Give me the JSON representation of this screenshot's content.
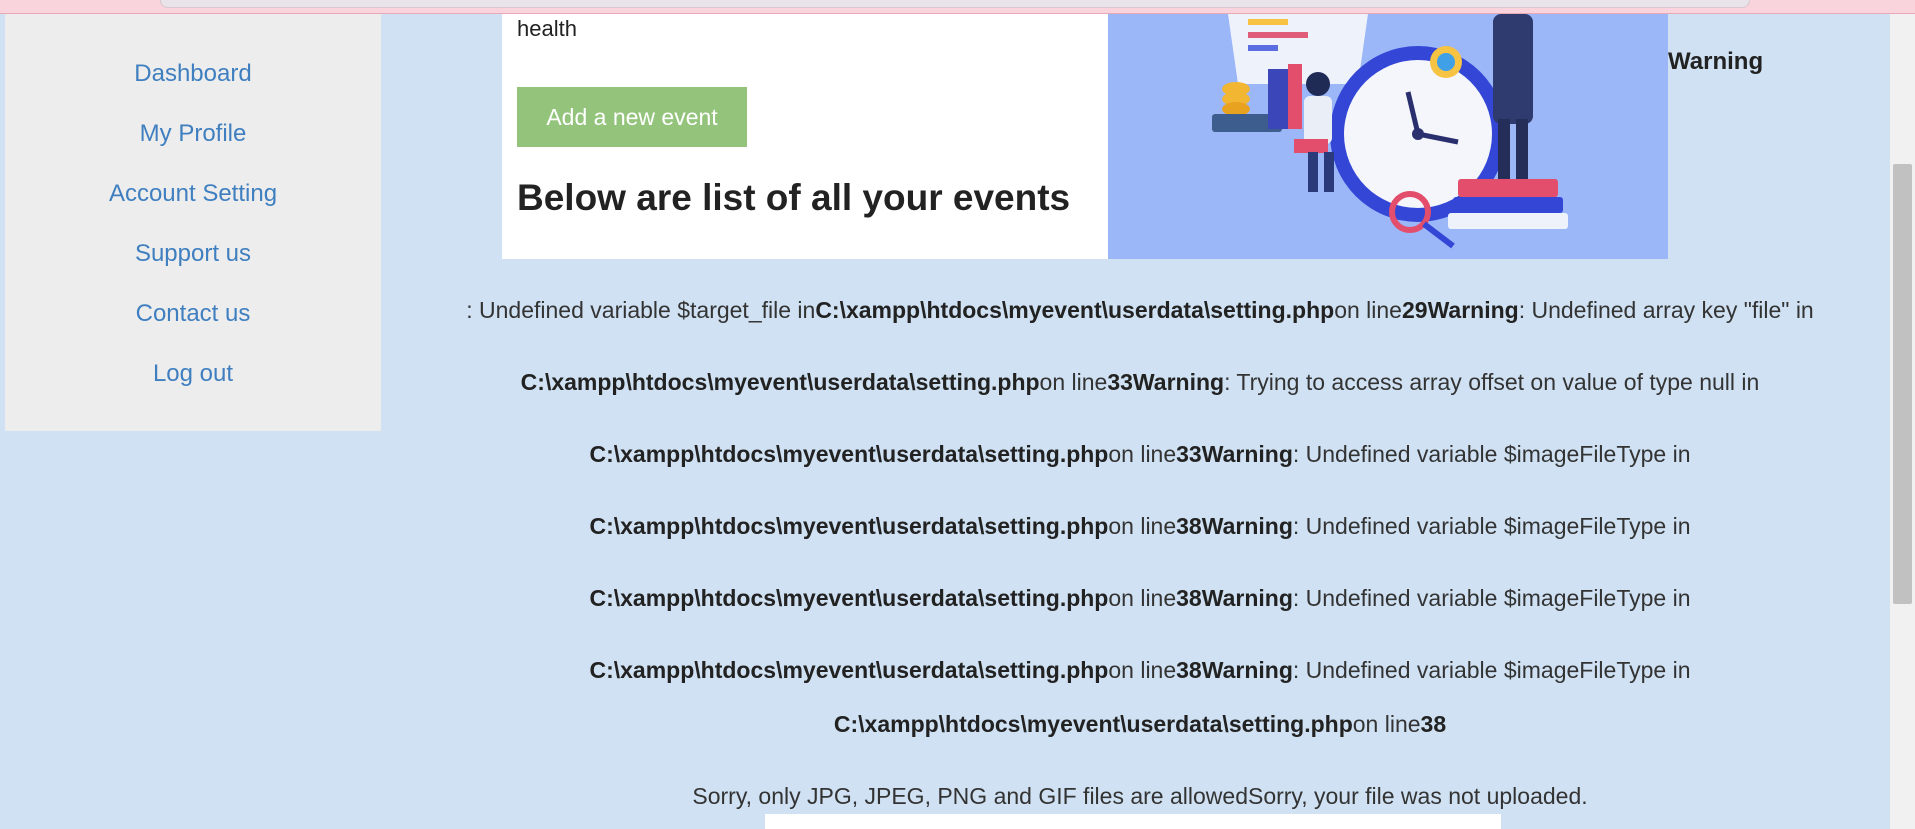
{
  "sidebar": {
    "items": [
      {
        "label": "Dashboard"
      },
      {
        "label": "My Profile"
      },
      {
        "label": "Account Setting"
      },
      {
        "label": "Support us"
      },
      {
        "label": "Contact us"
      },
      {
        "label": "Log out"
      }
    ]
  },
  "card": {
    "cut_text": "health",
    "add_button_label": "Add a new event",
    "heading": "Below are list of all your events"
  },
  "illustration": {
    "icon": "time-management-illustration"
  },
  "warning_top": "Warning",
  "errors": {
    "line1": {
      "a": ": Undefined variable $target_file in",
      "path": "C:\\xampp\\htdocs\\myevent\\userdata\\setting.php",
      "on_line": "on line",
      "num": "29",
      "warning": "Warning",
      "msg": ": Undefined array key \"file\" in"
    },
    "line2": {
      "path": "C:\\xampp\\htdocs\\myevent\\userdata\\setting.php",
      "on_line": "on line",
      "num": "33",
      "warning": "Warning",
      "msg": ": Trying to access array offset on value of type null in"
    },
    "line3": {
      "path": "C:\\xampp\\htdocs\\myevent\\userdata\\setting.php",
      "on_line": "on line",
      "num": "33",
      "warning": "Warning",
      "msg": ": Undefined variable $imageFileType in"
    },
    "line4": {
      "path": "C:\\xampp\\htdocs\\myevent\\userdata\\setting.php",
      "on_line": "on line",
      "num": "38",
      "warning": "Warning",
      "msg": ": Undefined variable $imageFileType in"
    },
    "line5": {
      "path": "C:\\xampp\\htdocs\\myevent\\userdata\\setting.php",
      "on_line": "on line",
      "num": "38",
      "warning": "Warning",
      "msg": ": Undefined variable $imageFileType in"
    },
    "line6": {
      "path": "C:\\xampp\\htdocs\\myevent\\userdata\\setting.php",
      "on_line": "on line",
      "num": "38",
      "warning": "Warning",
      "msg": ": Undefined variable $imageFileType in"
    },
    "line7": {
      "path": "C:\\xampp\\htdocs\\myevent\\userdata\\setting.php",
      "on_line": "on line",
      "num": "38"
    }
  },
  "sorry_message": "Sorry, only JPG, JPEG, PNG and GIF files are allowedSorry, your file was not uploaded.",
  "colors": {
    "page_bg": "#cfe1f2",
    "sidebar_bg": "#ededed",
    "link": "#3f7fc0",
    "button_bg": "#94c47c",
    "illustration_bg": "#9bb7f8"
  }
}
